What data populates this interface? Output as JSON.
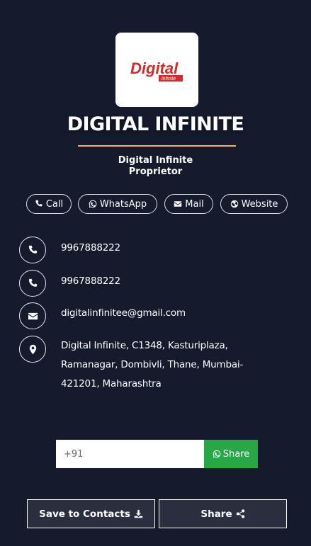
{
  "header": {
    "logo_text": "Digital",
    "logo_subtext": "infinite",
    "business_name": "DIGITAL INFINITE",
    "owner_name": "Digital Infinite",
    "owner_role": "Proprietor"
  },
  "actions": [
    {
      "label": "Call",
      "icon": "phone-icon"
    },
    {
      "label": "WhatsApp",
      "icon": "whatsapp-icon"
    },
    {
      "label": "Mail",
      "icon": "envelope-icon"
    },
    {
      "label": "Website",
      "icon": "globe-icon"
    }
  ],
  "contacts": [
    {
      "icon": "phone-icon",
      "text": "9967888222"
    },
    {
      "icon": "phone-icon",
      "text": "9967888222"
    },
    {
      "icon": "envelope-icon",
      "text": "digitalinfinitee@gmail.com"
    },
    {
      "icon": "map-marker-icon",
      "text": "Digital Infinite, C1348, Kasturiplaza, Ramanagar, Dombivli, Thane, Mumbai-421201, Maharashtra"
    }
  ],
  "share_bar": {
    "placeholder": "+91",
    "button_label": "Share"
  },
  "bottom": {
    "save_label": "Save to Contacts",
    "share_label": "Share"
  },
  "colors": {
    "background": "#151b2d",
    "accent_gold": "#e8b84a",
    "whatsapp_green": "#27a745",
    "logo_red": "#d42a2a"
  }
}
